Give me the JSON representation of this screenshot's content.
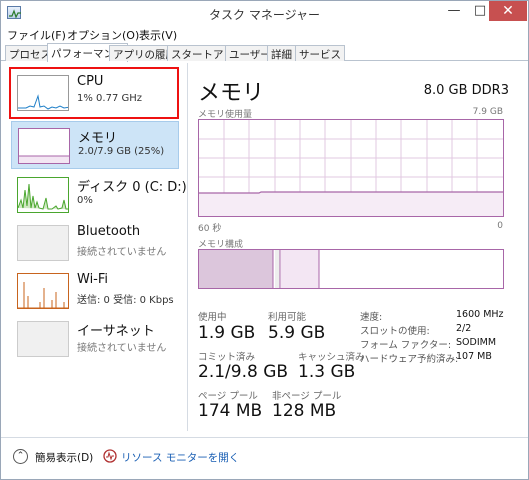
{
  "window": {
    "title": "タスク マネージャー"
  },
  "menu": [
    "ファイル(F)",
    "オプション(O)",
    "表示(V)"
  ],
  "tabs": [
    "プロセス",
    "パフォーマンス",
    "アプリの履歴",
    "スタートアップ",
    "ユーザー",
    "詳細",
    "サービス"
  ],
  "active_tab": "パフォーマンス",
  "sidebar": {
    "items": [
      {
        "title": "CPU",
        "sub": "1% 0.77 GHz"
      },
      {
        "title": "メモリ",
        "sub": "2.0/7.9 GB (25%)"
      },
      {
        "title": "ディスク 0 (C: D:)",
        "sub": "0%"
      },
      {
        "title": "Bluetooth",
        "sub": "接続されていません"
      },
      {
        "title": "Wi-Fi",
        "sub": "送信: 0 受信: 0 Kbps"
      },
      {
        "title": "イーサネット",
        "sub": "接続されていません"
      }
    ]
  },
  "main": {
    "title": "メモリ",
    "spec": "8.0 GB DDR3",
    "usage_label": "メモリ使用量",
    "usage_max": "7.9 GB",
    "time_left": "60 秒",
    "time_right": "0",
    "composition_label": "メモリ構成",
    "stats": {
      "in_use_label": "使用中",
      "in_use": "1.9 GB",
      "available_label": "利用可能",
      "available": "5.9 GB",
      "committed_label": "コミット済み",
      "committed": "2.1/9.8 GB",
      "cached_label": "キャッシュ済み",
      "cached": "1.3 GB",
      "paged_label": "ページ プール",
      "paged": "174 MB",
      "nonpaged_label": "非ページ プール",
      "nonpaged": "128 MB"
    },
    "specs": [
      {
        "label": "速度:",
        "value": "1600 MHz"
      },
      {
        "label": "スロットの使用:",
        "value": "2/2"
      },
      {
        "label": "フォーム ファクター:",
        "value": "SODIMM"
      },
      {
        "label": "ハードウェア予約済み:",
        "value": "107 MB"
      }
    ]
  },
  "footer": {
    "fewer_details": "簡易表示(D)",
    "resource_monitor": "リソース モニターを開く"
  },
  "colors": {
    "accent_memory": "#a866a8",
    "cpu_line": "#1e7fc8",
    "disk_line": "#4aa62e",
    "wifi_line": "#c8641e",
    "selection": "#cde4f7",
    "highlight_box": "#e11111"
  }
}
